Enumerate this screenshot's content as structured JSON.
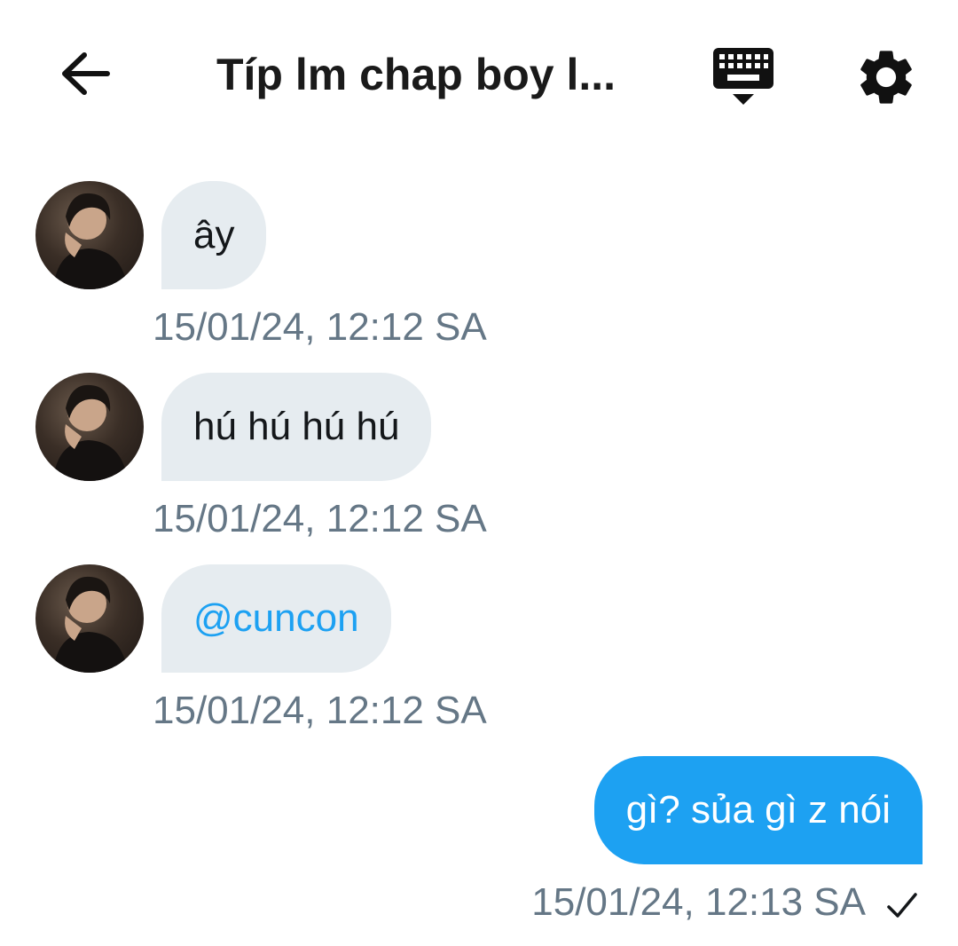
{
  "header": {
    "title": "Típ lm chap boy l...",
    "back_icon": "arrow-left-icon",
    "keyboard_icon": "keyboard-hide-icon",
    "settings_icon": "gear-icon"
  },
  "messages": [
    {
      "direction": "incoming",
      "text": "ây",
      "timestamp": "15/01/24, 12:12 SA"
    },
    {
      "direction": "incoming",
      "text": "hú hú hú hú",
      "timestamp": "15/01/24, 12:12 SA"
    },
    {
      "direction": "incoming",
      "text": "@cuncon",
      "timestamp": "15/01/24, 12:12 SA",
      "is_mention": true
    },
    {
      "direction": "outgoing",
      "text": "gì? sủa gì z nói",
      "timestamp": "15/01/24, 12:13 SA",
      "status_icon": "checkmark-icon"
    }
  ],
  "colors": {
    "accent": "#1da1f2",
    "incoming_bubble": "#e6ecf0",
    "timestamp": "#657786",
    "text": "#14171a"
  }
}
